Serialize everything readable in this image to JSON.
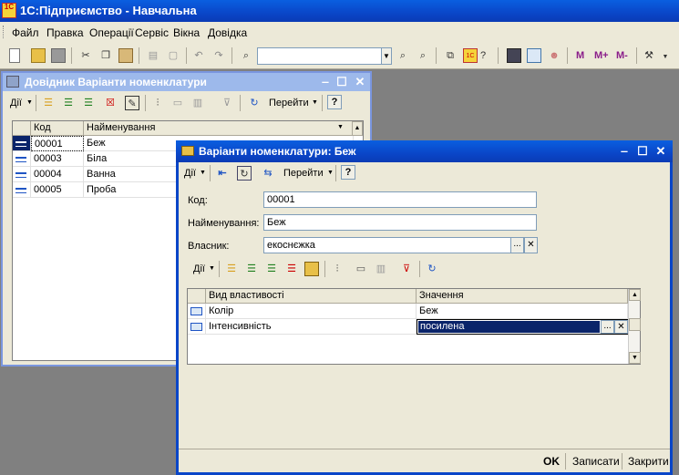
{
  "app": {
    "title": "1С:Підприємство - Навчальна",
    "logo": "1С"
  },
  "menu": [
    "Файл",
    "Правка",
    "Операції",
    "Сервіс",
    "Вікна",
    "Довідка"
  ],
  "toolbar": {
    "search_value": "",
    "mem_buttons": [
      "M",
      "M+",
      "M-"
    ]
  },
  "list_window": {
    "title": "Довідник Варіанти номенклатури",
    "actions_label": "Дії",
    "goto_label": "Перейти",
    "help": "?",
    "columns": [
      "Код",
      "Найменування"
    ],
    "rows": [
      {
        "code": "00001",
        "name": "Беж"
      },
      {
        "code": "00003",
        "name": "Біла"
      },
      {
        "code": "00004",
        "name": "Ванна"
      },
      {
        "code": "00005",
        "name": "Проба"
      }
    ]
  },
  "form_window": {
    "title": "Варіанти номенклатури: Беж",
    "actions_label": "Дії",
    "goto_label": "Перейти",
    "help": "?",
    "code_label": "Код:",
    "code_value": "00001",
    "name_label": "Найменування:",
    "name_value": "Беж",
    "owner_label": "Власник:",
    "owner_value": "екоснєжка",
    "props_actions_label": "Дії",
    "props_columns": [
      "Вид властивості",
      "Значення"
    ],
    "props_rows": [
      {
        "kind": "Колір",
        "value": "Беж"
      },
      {
        "kind": "Інтенсивність",
        "value": "посилена"
      }
    ],
    "ok_label": "OK",
    "save_label": "Записати",
    "close_label": "Закрити"
  },
  "colors": {
    "title_blue": "#0a46c8",
    "selection": "#0a246a",
    "panel": "#ece9d8"
  }
}
